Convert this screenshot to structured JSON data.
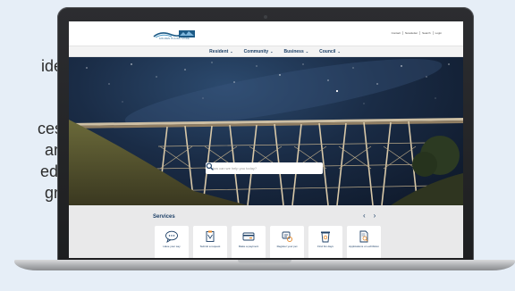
{
  "slide_fragments": {
    "line1": "ide",
    "line2": "ces",
    "line3": "an",
    "line4": "ed.",
    "line5": "gn"
  },
  "site": {
    "logo_caption": "GOLDEN PLAINS SHIRE",
    "utility_links": [
      "Contact",
      "Newsletter",
      "Search",
      "Login"
    ],
    "nav": [
      {
        "label": "Resident",
        "caret": "⌄"
      },
      {
        "label": "Community",
        "caret": "⌄"
      },
      {
        "label": "Business",
        "caret": "⌄"
      },
      {
        "label": "Council",
        "caret": "⌄"
      }
    ],
    "search": {
      "placeholder": "How can we help you today?",
      "icon": "search-icon"
    },
    "services": {
      "title": "Services",
      "prev": "‹",
      "next": "›",
      "tiles": [
        {
          "label": "Have your say",
          "icon": "speech-bubble-icon"
        },
        {
          "label": "Submit a request",
          "icon": "clipboard-icon"
        },
        {
          "label": "Make a payment",
          "icon": "payment-card-icon"
        },
        {
          "label": "Register your pet",
          "icon": "pet-tag-icon"
        },
        {
          "label": "Find bin days",
          "icon": "bin-icon"
        },
        {
          "label": "Applications on exhibition",
          "icon": "document-search-icon"
        }
      ]
    }
  },
  "colors": {
    "brand_navy": "#1c3f66",
    "accent_orange": "#e58a2c",
    "services_bg": "#e9e9ea",
    "slide_bg": "#e6eef7"
  }
}
